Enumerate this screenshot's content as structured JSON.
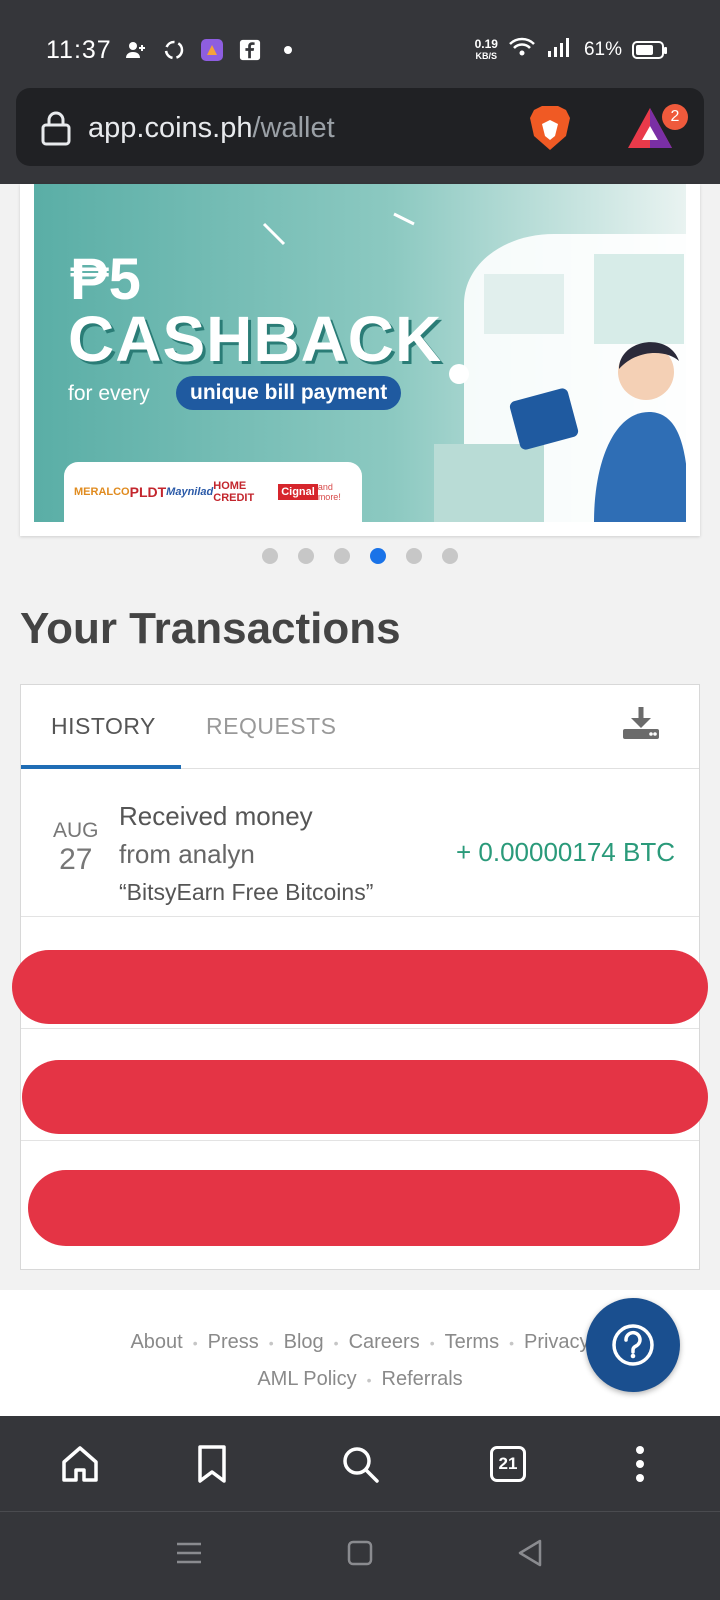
{
  "status_bar": {
    "time": "11:37",
    "net_speed_value": "0.19",
    "net_speed_unit": "KB/S",
    "battery": "61%"
  },
  "url_bar": {
    "domain": "app.coins.ph",
    "path": "/wallet",
    "rewards_badge": "2"
  },
  "banner": {
    "peso": "₱5",
    "headline": "CASHBACK",
    "for_every": "for every",
    "pill": "unique bill payment",
    "partners": [
      "MERALCO",
      "PLDT",
      "Maynilad",
      "HOME CREDIT",
      "Cignal",
      "and more!"
    ],
    "page_dots": 6,
    "active_dot": 4
  },
  "transactions": {
    "title": "Your Transactions",
    "tabs": [
      "HISTORY",
      "REQUESTS"
    ],
    "active_tab": "HISTORY",
    "rows": [
      {
        "month": "AUG",
        "day": "27",
        "line1": "Received money",
        "line2": "from analyn",
        "line3": "“BitsyEarn Free Bitcoins”",
        "amount": "+ 0.00000174 BTC"
      }
    ]
  },
  "footer": {
    "links_row1": [
      "About",
      "Press",
      "Blog",
      "Careers",
      "Terms",
      "Privacy"
    ],
    "links_row2": [
      "AML Policy",
      "Referrals"
    ]
  },
  "toolbar": {
    "tab_count": "21"
  },
  "colors": {
    "accent_blue": "#1a73e8",
    "help_button": "#1a4f8f",
    "amount_green": "#2a9a7a",
    "redaction_red": "#e43445",
    "browser_chrome": "#35363a"
  }
}
